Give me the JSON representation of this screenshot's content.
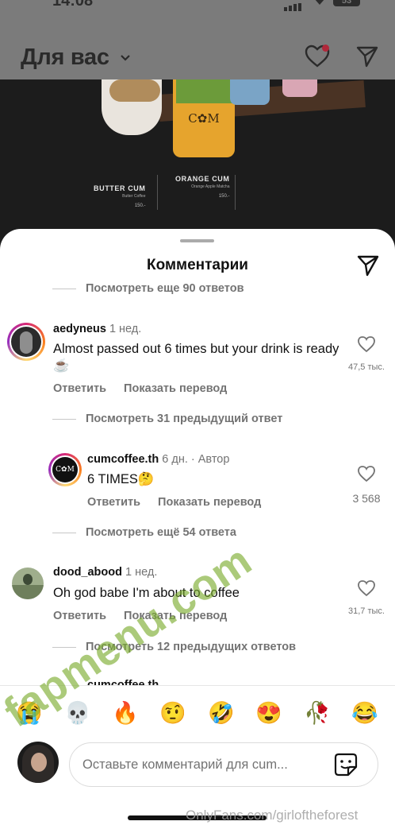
{
  "status_bar": {
    "time": "14:08",
    "battery": "53"
  },
  "feed": {
    "title": "Для вас"
  },
  "photo": {
    "logo": "C✿M",
    "items": [
      {
        "name": "BUTTER CUM",
        "desc": "Butter Coffee",
        "price": "150.-"
      },
      {
        "name": "ORANGE CUM",
        "desc": "Orange Apple Matcha",
        "price": "150.-"
      }
    ]
  },
  "sheet": {
    "title": "Комментарии",
    "view_top": "Посмотреть еще 90 ответов",
    "comments": [
      {
        "username": "aedyneus",
        "meta": "1 нед.",
        "text": "Almost passed out 6 times but your drink is ready ☕",
        "reply": "Ответить",
        "translate": "Показать перевод",
        "likes": "47,5 тыс."
      },
      {
        "view_prev": "Посмотреть 31 предыдущий ответ"
      },
      {
        "username": "cumcoffee.th",
        "meta": "6 дн. · Автор",
        "text": "6 TIMES🤔",
        "reply": "Ответить",
        "translate": "Показать перевод",
        "likes": "3 568"
      },
      {
        "view_more": "Посмотреть ещё 54 ответа"
      },
      {
        "username": "dood_abood",
        "meta": "1 нед.",
        "text": "Oh god babe I'm about to coffee",
        "reply": "Ответить",
        "translate": "Показать перевод",
        "likes": "31,7 тыс."
      },
      {
        "view_prev": "Посмотреть 12 предыдущих ответов"
      }
    ],
    "partial_user": "cumcoffee.th",
    "emojis": [
      "😭",
      "💀",
      "🔥",
      "🤨",
      "🤣",
      "😍",
      "🥀",
      "😂"
    ],
    "compose_placeholder": "Оставьте комментарий для cum..."
  },
  "watermarks": {
    "site": "fapmenu.com",
    "onlyfans": "OnlyFans.com/girloftheforest"
  }
}
